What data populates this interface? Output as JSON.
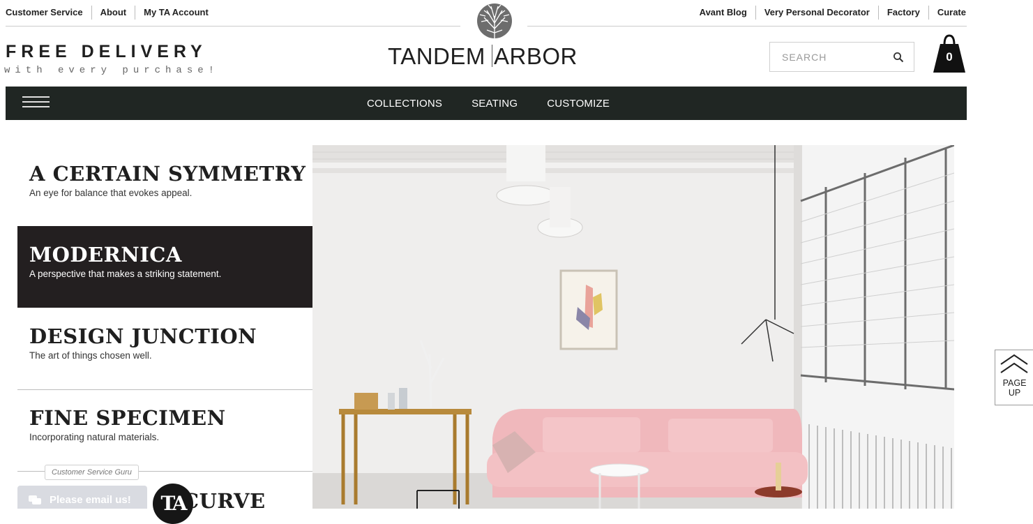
{
  "util_nav": {
    "left": [
      "Customer Service",
      "About",
      "My TA Account"
    ],
    "right": [
      "Avant Blog",
      "Very Personal Decorator",
      "Factory",
      "Curate"
    ]
  },
  "promo": {
    "title": "FREE DELIVERY",
    "subtitle": "with every purchase!"
  },
  "brand": {
    "name_left": "TANDEM",
    "name_right": "ARBOR",
    "logo_icon": "tree-logo-icon"
  },
  "search": {
    "placeholder": "SEARCH",
    "icon": "search-icon"
  },
  "cart": {
    "count": "0",
    "icon": "shopping-bag-icon"
  },
  "main_nav": {
    "menu_icon": "hamburger-icon",
    "items": [
      "COLLECTIONS",
      "SEATING",
      "CUSTOMIZE"
    ]
  },
  "collections": [
    {
      "title": "A CERTAIN SYMMETRY",
      "description": "An eye for balance that evokes appeal.",
      "active": false
    },
    {
      "title": "MODERNICA",
      "description": "A perspective that makes a striking statement.",
      "active": true
    },
    {
      "title": "DESIGN JUNCTION",
      "description": "The art of things chosen well.",
      "active": false
    },
    {
      "title": "FINE SPECIMEN",
      "description": "Incorporating natural materials.",
      "active": false
    }
  ],
  "partial_collection_title": "CURVE",
  "page_up": {
    "line1": "PAGE",
    "line2": "UP",
    "icon": "double-chevron-up-icon"
  },
  "chat": {
    "label": "Customer Service Guru",
    "button": "Please email us!",
    "badge": "TA"
  },
  "colors": {
    "navbar": "#202623",
    "active_panel": "#231f20",
    "sofa": "#f0b8bc"
  }
}
